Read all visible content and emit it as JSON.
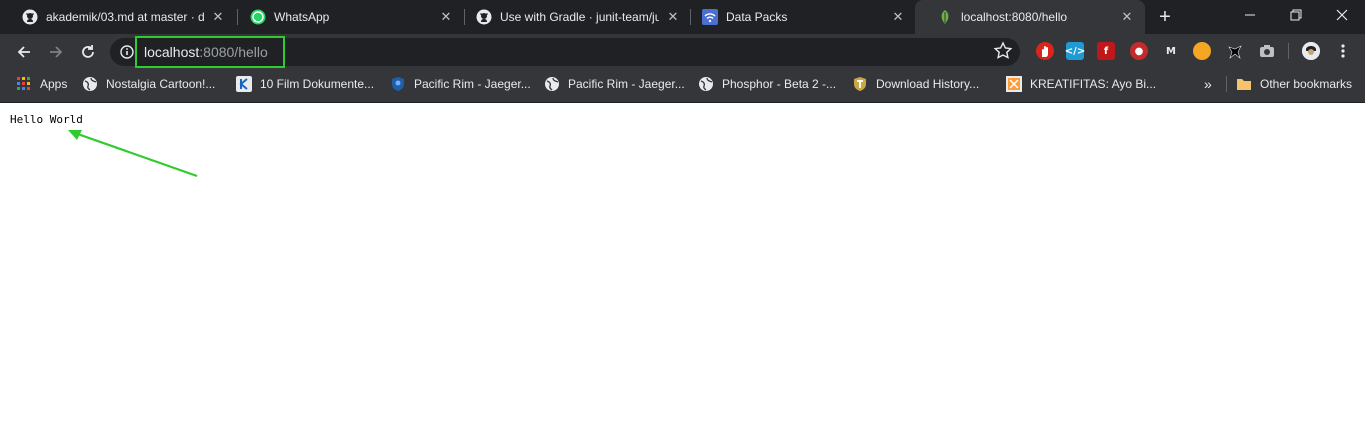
{
  "tabs": [
    {
      "title": "akademik/03.md at master · du",
      "icon": "github-icon"
    },
    {
      "title": "WhatsApp",
      "icon": "whatsapp-icon"
    },
    {
      "title": "Use with Gradle · junit-team/ju",
      "icon": "github-icon"
    },
    {
      "title": "Data Packs",
      "icon": "wifi-icon"
    },
    {
      "title": "localhost:8080/hello",
      "icon": "leaf-icon"
    }
  ],
  "omnibox": {
    "host": "localhost",
    "rest": ":8080/hello"
  },
  "bookmarks": [
    {
      "label": "Apps",
      "icon": "apps-grid-icon"
    },
    {
      "label": "Nostalgia Cartoon!...",
      "icon": "globe-icon"
    },
    {
      "label": "10 Film Dokumente...",
      "icon": "k-icon"
    },
    {
      "label": "Pacific Rim - Jaeger...",
      "icon": "shield-icon"
    },
    {
      "label": "Pacific Rim - Jaeger...",
      "icon": "globe-icon"
    },
    {
      "label": "Phosphor - Beta 2 -...",
      "icon": "globe-icon"
    },
    {
      "label": "Download History...",
      "icon": "t-icon"
    },
    {
      "label": "KREATIFITAS: Ayo Bi...",
      "icon": "blog-icon"
    },
    {
      "label": "Other bookmarks",
      "icon": "folder-icon"
    }
  ],
  "bookmarks_more": "»",
  "page": {
    "text": "Hello World"
  },
  "colors": {
    "highlight": "#2ecc2e",
    "tab_bg": "#202124",
    "toolbar_bg": "#35363a"
  }
}
